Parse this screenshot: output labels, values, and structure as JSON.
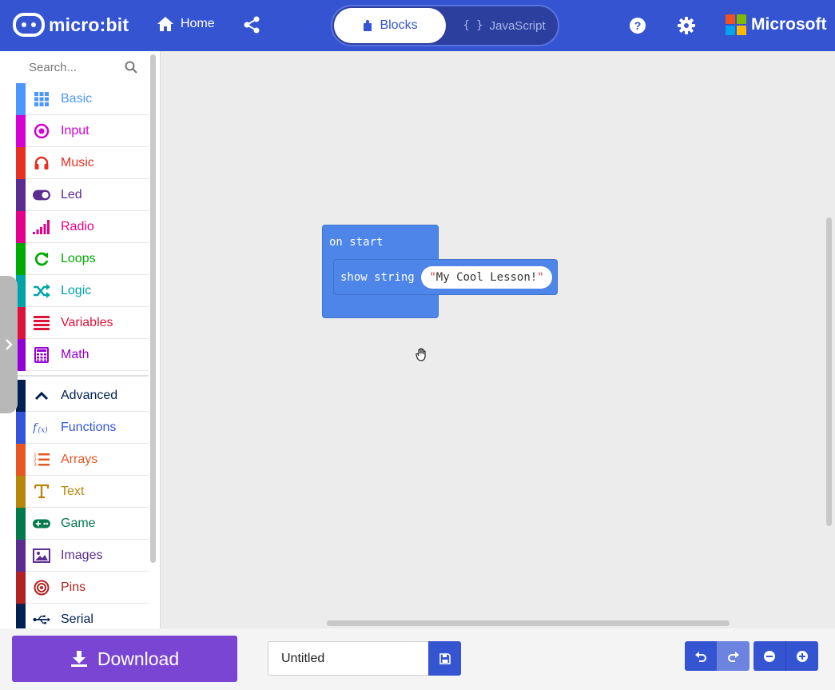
{
  "header": {
    "logo_text": "micro:bit",
    "home_label": "Home",
    "mode_blocks_label": "Blocks",
    "mode_javascript_label": "JavaScript",
    "brand_text": "Microsoft",
    "colors": {
      "header_bg": "#3454d1",
      "ms_red": "#f25022",
      "ms_green": "#7fba00",
      "ms_blue": "#00a4ef",
      "ms_yellow": "#ffb900"
    }
  },
  "toolbox": {
    "search_placeholder": "Search...",
    "categories": [
      {
        "label": "Basic",
        "color": "#4c97ff",
        "icon": "grid-icon"
      },
      {
        "label": "Input",
        "color": "#d400d4",
        "icon": "target-icon"
      },
      {
        "label": "Music",
        "color": "#e63022",
        "icon": "headphones-icon"
      },
      {
        "label": "Led",
        "color": "#5c2d91",
        "icon": "toggle-icon"
      },
      {
        "label": "Radio",
        "color": "#e3008c",
        "icon": "signal-bars-icon"
      },
      {
        "label": "Loops",
        "color": "#00aa00",
        "icon": "refresh-icon"
      },
      {
        "label": "Logic",
        "color": "#00a4a6",
        "icon": "shuffle-icon"
      },
      {
        "label": "Variables",
        "color": "#dc143c",
        "icon": "lines-icon"
      },
      {
        "label": "Math",
        "color": "#9400d3",
        "icon": "calculator-icon"
      }
    ],
    "advanced": {
      "label": "Advanced",
      "color": "#002050",
      "icon": "chevron-up-icon"
    },
    "advanced_categories": [
      {
        "label": "Functions",
        "color": "#3455db",
        "icon": "function-icon"
      },
      {
        "label": "Arrays",
        "color": "#e65722",
        "icon": "numbered-list-icon"
      },
      {
        "label": "Text",
        "color": "#b8860b",
        "icon": "text-icon"
      },
      {
        "label": "Game",
        "color": "#007a4b",
        "icon": "gamepad-icon"
      },
      {
        "label": "Images",
        "color": "#5c2d91",
        "icon": "image-icon"
      },
      {
        "label": "Pins",
        "color": "#b22222",
        "icon": "pin-target-icon"
      },
      {
        "label": "Serial",
        "color": "#002050",
        "icon": "usb-icon"
      }
    ]
  },
  "workspace": {
    "on_start_label": "on start",
    "show_string_label": "show string",
    "string_value": "My Cool Lesson!",
    "quote": "\"",
    "block_color": "#4d86e8"
  },
  "bottom": {
    "download_label": "Download",
    "project_name": "Untitled",
    "download_color": "#7a45d3"
  }
}
